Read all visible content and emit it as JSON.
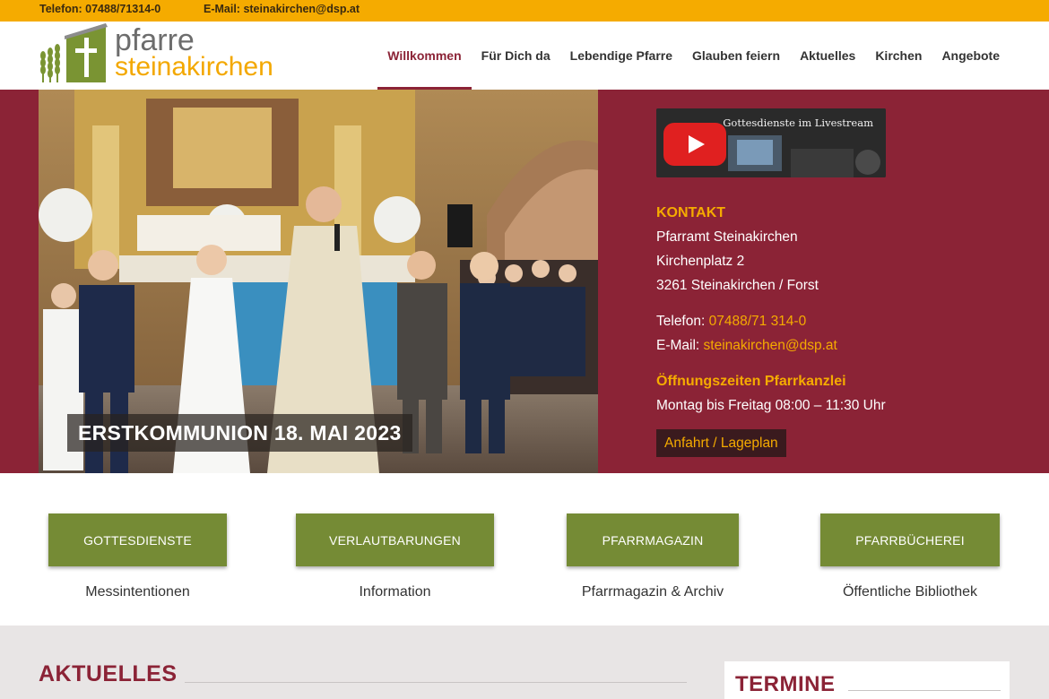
{
  "topbar": {
    "phone": "Telefon: 07488/71314-0",
    "email": "E-Mail: steinakirchen@dsp.at"
  },
  "logo": {
    "line1": "pfarre",
    "line2": "steinakirchen"
  },
  "nav": {
    "items": [
      "Willkommen",
      "Für Dich da",
      "Lebendige Pfarre",
      "Glauben feiern",
      "Aktuelles",
      "Kirchen",
      "Angebote"
    ],
    "active": "Willkommen"
  },
  "hero": {
    "caption": "ERSTKOMMUNION 18. MAI 2023",
    "livestream_label": "Gottesdienste im Livestream"
  },
  "contact": {
    "heading": "KONTAKT",
    "name": "Pfarramt Steinakirchen",
    "street": "Kirchenplatz 2",
    "city": "3261 Steinakirchen / Forst",
    "phone_label": "Telefon:",
    "phone": "07488/71 314-0",
    "email_label": "E-Mail:",
    "email": "steinakirchen@dsp.at",
    "hours_heading": "Öffnungszeiten Pfarrkanzlei",
    "hours": "Montag bis Freitag 08:00 – 11:30 Uhr",
    "map_button": "Anfahrt / Lageplan"
  },
  "quicklinks": [
    {
      "label": "GOTTESDIENSTE",
      "sub": "Messintentionen"
    },
    {
      "label": "VERLAUTBARUNGEN",
      "sub": "Information"
    },
    {
      "label": "PFARRMAGAZIN",
      "sub": "Pfarrmagazin & Archiv"
    },
    {
      "label": "PFARRBÜCHEREI",
      "sub": "Öffentliche Bibliothek"
    }
  ],
  "sections": {
    "aktuelles": "AKTUELLES",
    "termine": "TERMINE"
  },
  "colors": {
    "accent_orange": "#f5ab00",
    "burgundy": "#8b2336",
    "olive": "#758b35"
  }
}
